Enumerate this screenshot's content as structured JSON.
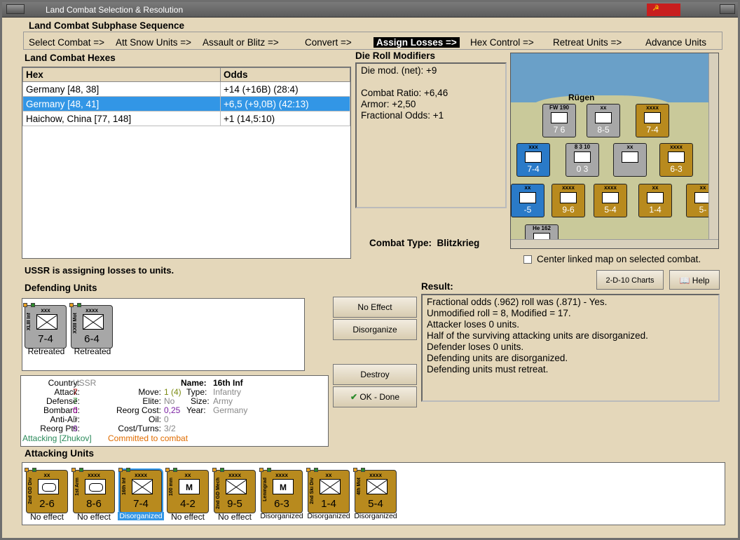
{
  "window": {
    "title": "Land Combat Selection & Resolution",
    "flag": "☭"
  },
  "subphase": {
    "heading": "Land Combat Subphase Sequence",
    "items": [
      "Select Combat =>",
      "Att Snow Units =>",
      "Assault or Blitz =>",
      "Convert =>",
      "Assign Losses =>",
      "Hex Control =>",
      "Retreat Units =>",
      "Advance Units"
    ]
  },
  "hexes": {
    "heading": "Land Combat Hexes",
    "col_hex": "Hex",
    "col_odds": "Odds",
    "rows": [
      {
        "hex": "Germany [48, 38]",
        "odds": "+14 (+16B) (28:4)"
      },
      {
        "hex": "Germany [48, 41]",
        "odds": "+6,5 (+9,0B) (42:13)"
      },
      {
        "hex": "Haichow, China [77, 148]",
        "odds": "+1 (14,5:10)"
      }
    ]
  },
  "die": {
    "heading": "Die Roll Modifiers",
    "net": "Die mod. (net): +9",
    "ratio": "Combat Ratio: +6,46",
    "armor": "Armor: +2,50",
    "frac": "Fractional Odds: +1"
  },
  "combat_type": {
    "label": "Combat Type:",
    "value": "Blitzkrieg"
  },
  "center_label": "Center linked map on selected combat.",
  "map": {
    "place": "Rügen",
    "counters": [
      {
        "name": "map-counter-fw190",
        "label": "FW 190",
        "str": "7  6",
        "color": "grey"
      },
      {
        "name": "map-counter-1st-inf",
        "label": "xx",
        "str": "8-5",
        "color": "grey"
      },
      {
        "name": "map-counter-3rd-inf",
        "label": "xxxx",
        "str": "7-4",
        "color": "tan"
      },
      {
        "name": "map-counter-1st-gd-mot",
        "label": "xxx",
        "str": "7-4",
        "color": "blue"
      },
      {
        "name": "map-counter-air",
        "label": "8  3  10",
        "str": "0  3",
        "color": "grey"
      },
      {
        "name": "map-counter-target",
        "label": "xx",
        "str": "",
        "color": "grey"
      },
      {
        "name": "map-counter-leningrad",
        "label": "xxxx",
        "str": "6-3",
        "color": "tan"
      },
      {
        "name": "map-counter-left",
        "label": "xx",
        "str": "-5",
        "color": "blue"
      },
      {
        "name": "map-counter-1st-arm",
        "label": "xxxx",
        "str": "9-6",
        "color": "tan"
      },
      {
        "name": "map-counter-4th-mot",
        "label": "xxxx",
        "str": "5-4",
        "color": "tan"
      },
      {
        "name": "map-counter-2nd-ski",
        "label": "xx",
        "str": "1-4",
        "color": "tan"
      },
      {
        "name": "map-counter-right",
        "label": "xx",
        "str": "5-",
        "color": "tan"
      },
      {
        "name": "map-counter-he162",
        "label": "He 162",
        "str": "",
        "color": "grey"
      }
    ]
  },
  "buttons": {
    "charts": "2-D-10 Charts",
    "help": "Help",
    "no_effect": "No Effect",
    "disorganize": "Disorganize",
    "destroy": "Destroy",
    "ok": "OK - Done"
  },
  "status": "USSR is assigning losses to units.",
  "defending": {
    "heading": "Defending Units",
    "units": [
      {
        "size": "xxx",
        "side": "XLIII Inf",
        "str": "7-4",
        "sym": "x",
        "label": "Retreated"
      },
      {
        "size": "xxxx",
        "side": "XXIII Mot",
        "str": "6-4",
        "sym": "x",
        "label": "Retreated"
      }
    ]
  },
  "result": {
    "heading": "Result:",
    "lines": [
      "Fractional odds (.962) roll was (.871)  - Yes.",
      "Unmodified roll = 8, Modified = 17.",
      "Attacker loses 0 units.",
      "Half of the surviving attacking units are disorganized.",
      "Defender loses 0 units.",
      "Defending units are disorganized.",
      "Defending units must retreat."
    ]
  },
  "unitinfo": {
    "country_k": "Country:",
    "country_v": "USSR",
    "attack_k": "Attack:",
    "attack_v": "7",
    "defense_k": "Defense:",
    "defense_v": "7",
    "bombard_k": "Bombard:",
    "bombard_v": "0",
    "antiair_k": "Anti-Air:",
    "antiair_v": "0",
    "reorg_k": "Reorg Pts:",
    "reorg_v": "0",
    "name_k": "Name:",
    "name_v": "16th Inf",
    "move_k": "Move:",
    "move_v": "1 (4)",
    "type_k": "Type:",
    "type_v": "Infantry",
    "elite_k": "Elite:",
    "elite_v": "No",
    "size_k": "Size:",
    "size_v": "Army",
    "reorgcost_k": "Reorg Cost:",
    "reorgcost_v": "0,25",
    "year_k": "Year:",
    "year_v": "Germany",
    "oil_k": "Oil:",
    "oil_v": "0",
    "cost_k": "Cost/Turns:",
    "cost_v": "3/2",
    "attacking": "Attacking [Zhukov]",
    "committed": "Committed to combat"
  },
  "attacking": {
    "heading": "Attacking Units",
    "units": [
      {
        "size": "xx",
        "side": "2nd GD Div",
        "str": "2-6",
        "sym": "arm",
        "label": "No effect"
      },
      {
        "size": "xxxx",
        "side": "1st Arm",
        "str": "8-6",
        "sym": "arm",
        "label": "No effect"
      },
      {
        "size": "xxxx",
        "side": "16th Inf",
        "str": "7-4",
        "sym": "x",
        "label": "Disorganized"
      },
      {
        "size": "xx",
        "side": "100 mm",
        "str": "4-2",
        "sym": "letter",
        "label": "No effect"
      },
      {
        "size": "xxxx",
        "side": "2nd GD Mech",
        "str": "9-5",
        "sym": "x",
        "label": "No effect"
      },
      {
        "size": "xxxx",
        "side": "Leningrad",
        "str": "6-3",
        "sym": "letter",
        "label": "Disorganized"
      },
      {
        "size": "xx",
        "side": "2nd Ski Div",
        "str": "1-4",
        "sym": "x",
        "label": "Disorganized"
      },
      {
        "size": "xxxx",
        "side": "4th Mot",
        "str": "5-4",
        "sym": "x",
        "label": "Disorganized"
      }
    ]
  },
  "colors": {
    "selected": "#3296e6",
    "attack": "#c81e1e",
    "defense": "#2a8a2a",
    "bombard": "#b000b0",
    "reorg": "#7a1fa2",
    "committed": "#e06c00",
    "attacking": "#2a8a5a"
  }
}
